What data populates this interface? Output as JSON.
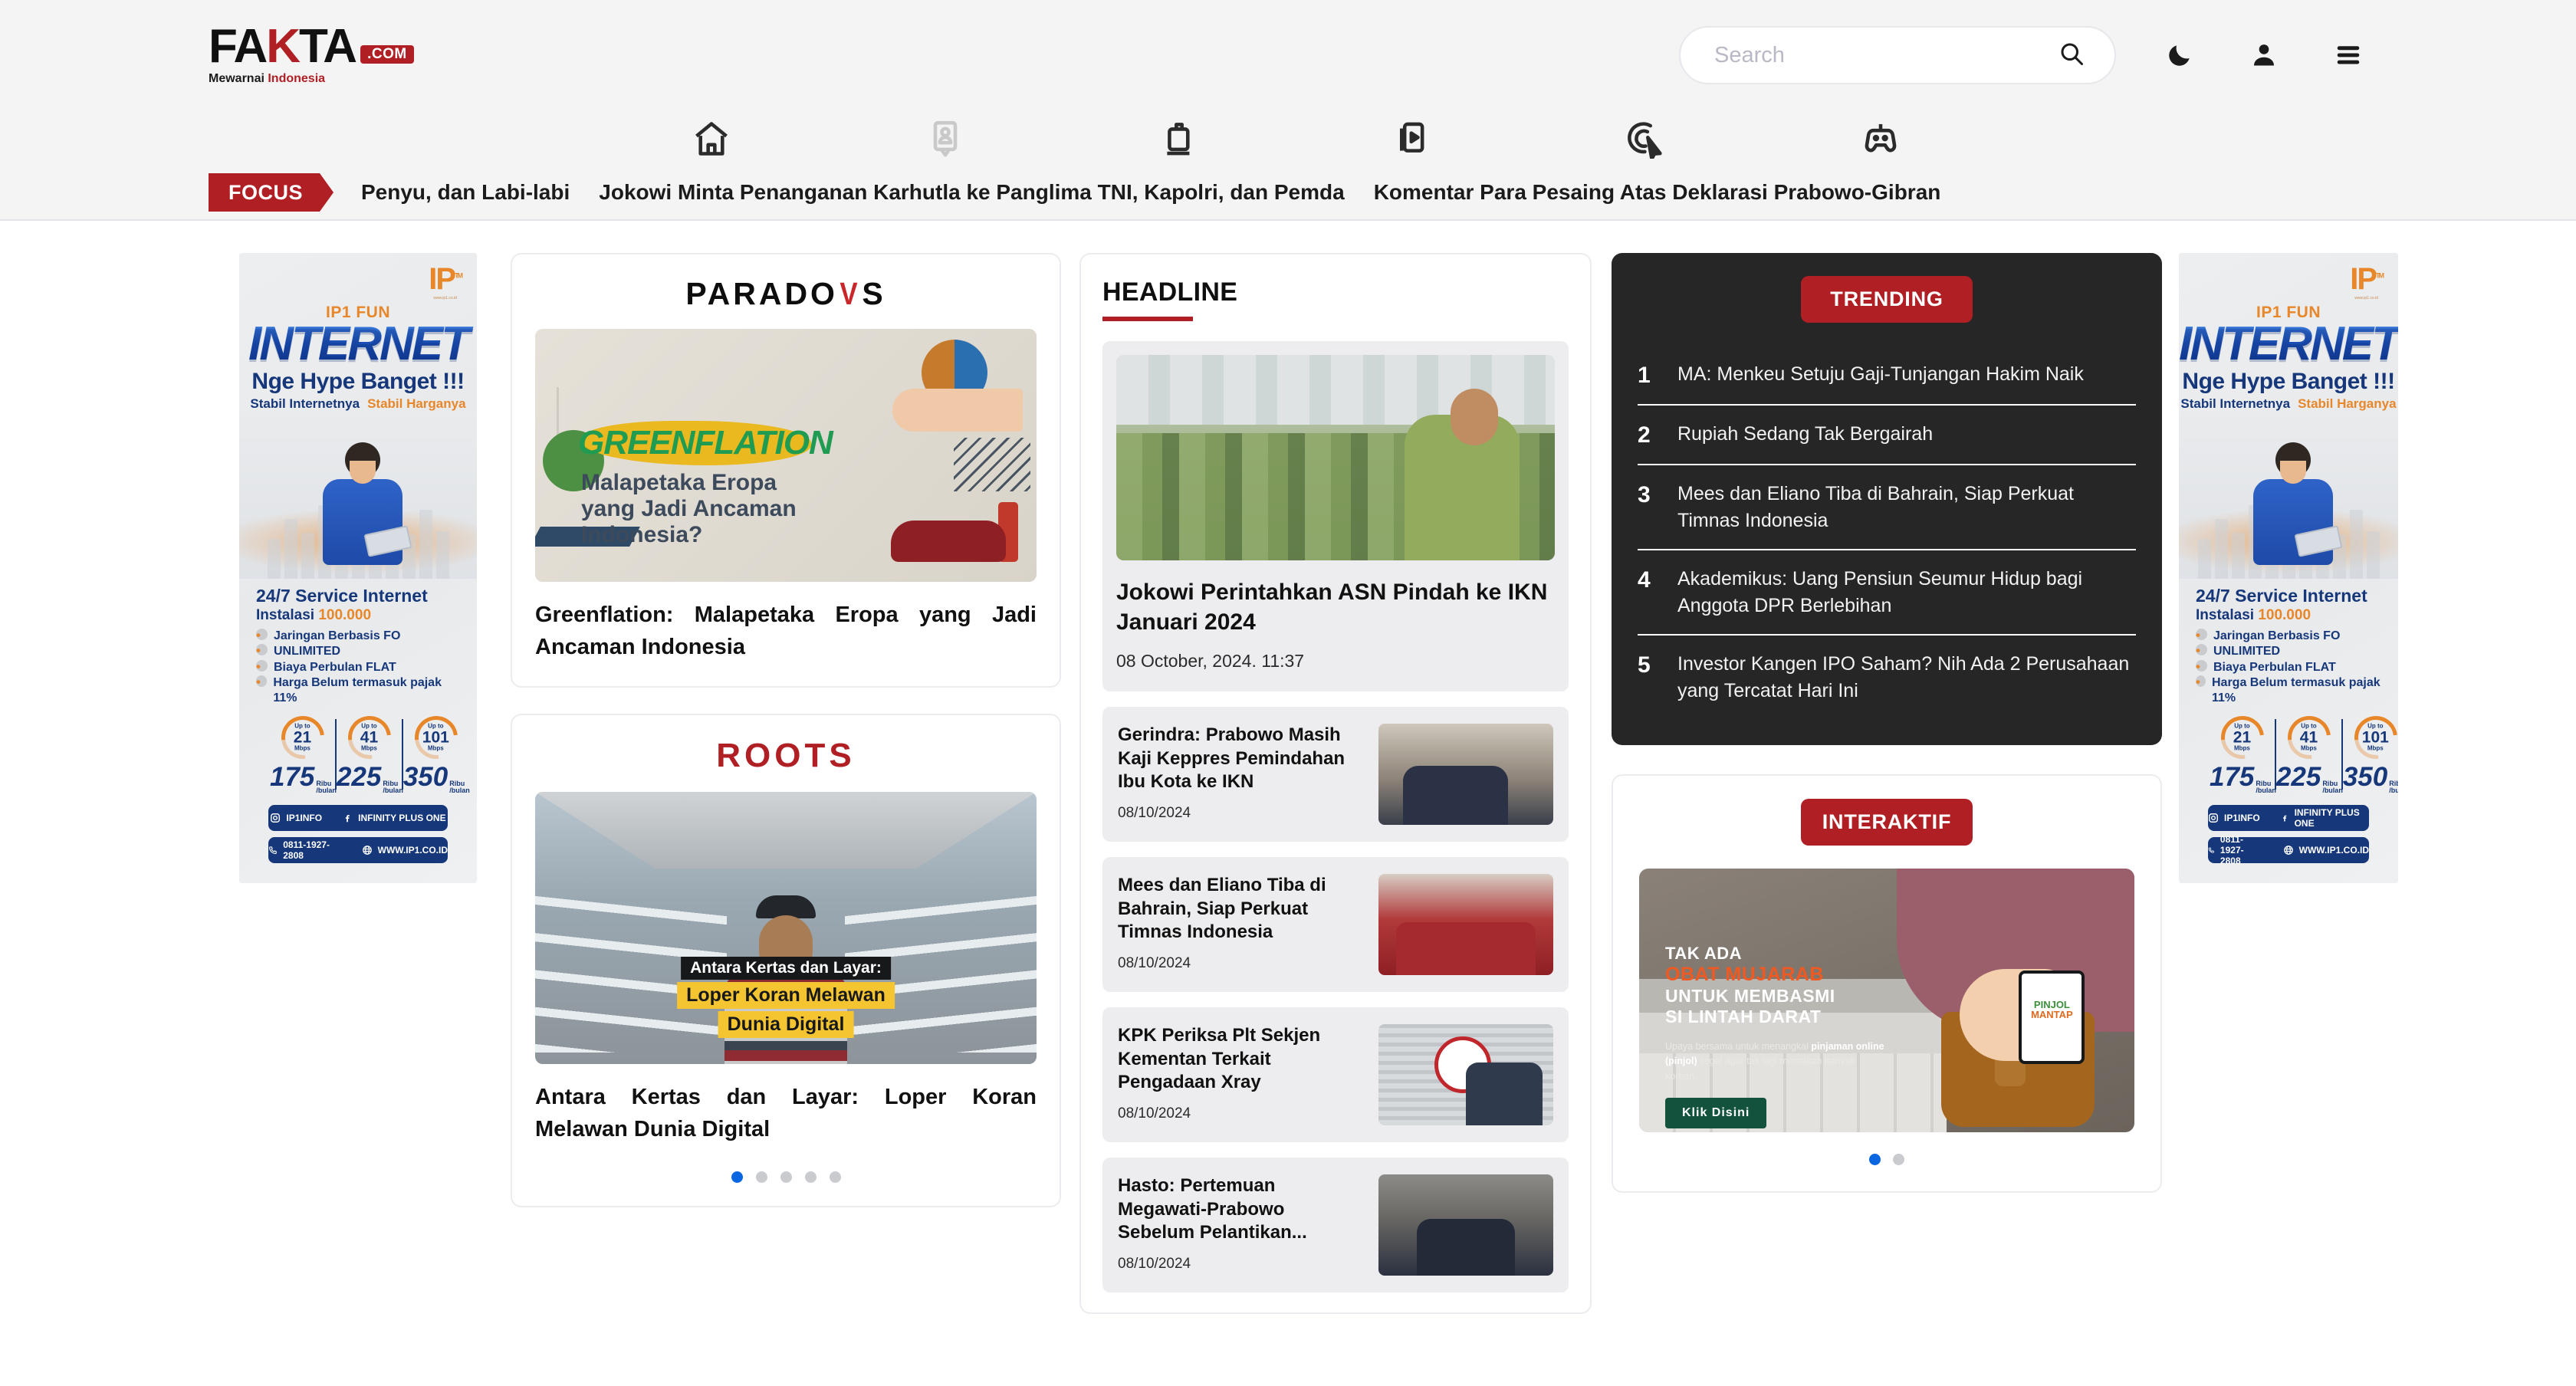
{
  "site": {
    "logo_main": "FA",
    "logo_check": "K",
    "logo_rest": "TA",
    "logo_dotcom": ".COM",
    "tagline_a": "Mewarnai ",
    "tagline_b": "Indonesia"
  },
  "search": {
    "placeholder": "Search",
    "value": ""
  },
  "header_icons": [
    {
      "name": "dark-mode-icon",
      "label": "Dark mode"
    },
    {
      "name": "account-icon",
      "label": "Account"
    },
    {
      "name": "menu-icon",
      "label": "Menu"
    }
  ],
  "nav": [
    {
      "name": "home",
      "label": "Home"
    },
    {
      "name": "profile",
      "label": "Profil"
    },
    {
      "name": "briefcase",
      "label": "Bisnis"
    },
    {
      "name": "video",
      "label": "Video"
    },
    {
      "name": "click",
      "label": "Interaktif"
    },
    {
      "name": "gamepad",
      "label": "Game"
    }
  ],
  "focus": {
    "badge": "FOCUS",
    "items": [
      "Penyu, dan Labi-labi",
      "Jokowi Minta Penanganan Karhutla ke Panglima TNI, Kapolri, dan Pemda",
      "Komentar Para Pesaing Atas Deklarasi Prabowo-Gibran"
    ]
  },
  "ad": {
    "ip1_mark": "IP",
    "ip1_one": "1",
    "ip1_tm": "TM",
    "ip1_sub": "Your Trusted IoT Partner\nwww.ip1.co.id",
    "fun": "IP1 FUN",
    "internet": "INTERNET",
    "hype": "Nge Hype Banget !!!",
    "stabil_net": "Stabil Internetnya",
    "stabil_harga": "Stabil Harganya",
    "service_title": "24/7 Service Internet",
    "instalasi_label": "Instalasi ",
    "instalasi_value": "100.000",
    "features": [
      "Jaringan Berbasis FO",
      "UNLIMITED",
      "Biaya Perbulan FLAT",
      "Harga Belum termasuk pajak 11%"
    ],
    "speeds": [
      {
        "upto": "Up to",
        "num": "21",
        "unit": "Mbps",
        "price": "175",
        "per_a": "Ribu",
        "per_b": "/bulan"
      },
      {
        "upto": "Up to",
        "num": "41",
        "unit": "Mbps",
        "price": "225",
        "per_a": "Ribu",
        "per_b": "/bulan"
      },
      {
        "upto": "Up to",
        "num": "101",
        "unit": "Mbps",
        "price": "350",
        "per_a": "Ribu",
        "per_b": "/bulan"
      }
    ],
    "instagram": "IP1INFO",
    "facebook": "INFINITY PLUS ONE",
    "phone": "0811-1927-2808",
    "website": "WWW.IP1.CO.ID"
  },
  "feature_cards": [
    {
      "brand": "PARADOKS",
      "brand_pre": "PARADO",
      "brand_v": "V",
      "brand_post": "S",
      "art": {
        "word": "GREENFLATION",
        "sub_l1": "Malapetaka Eropa",
        "sub_l2": "yang Jadi Ancaman",
        "sub_l3": "Indonesia?"
      },
      "title": "Greenflation: Malapetaka Eropa yang Jadi Ancaman Indonesia"
    },
    {
      "brand": "ROOTS",
      "brand_pre": "ROO",
      "brand_v": "T",
      "brand_post": "S",
      "art": {
        "cap1": "Antara Kertas dan Layar:",
        "cap2": "Loper Koran Melawan",
        "cap3": "Dunia Digital"
      },
      "title": "Antara Kertas dan Layar: Loper Koran Melawan Dunia Digital",
      "dots": {
        "count": 5,
        "active": 0
      }
    }
  ],
  "headline": {
    "section_title": "HEADLINE",
    "main": {
      "title": "Jokowi Perintahkan ASN Pindah ke IKN Januari 2024",
      "date": "08 October, 2024. 11:37"
    },
    "items": [
      {
        "title": "Gerindra: Prabowo Masih Kaji Keppres Pemindahan Ibu Kota ke IKN",
        "date": "08/10/2024"
      },
      {
        "title": "Mees dan Eliano Tiba di Bahrain, Siap Perkuat Timnas Indonesia",
        "date": "08/10/2024"
      },
      {
        "title": "KPK Periksa Plt Sekjen Kementan Terkait Pengadaan Xray",
        "date": "08/10/2024"
      },
      {
        "title": "Hasto: Pertemuan Megawati-Prabowo Sebelum Pelantikan...",
        "date": "08/10/2024"
      }
    ]
  },
  "trending": {
    "title": "TRENDING",
    "items": [
      {
        "rank": "1",
        "title": "MA: Menkeu Setuju Gaji-Tunjangan Hakim Naik"
      },
      {
        "rank": "2",
        "title": "Rupiah Sedang Tak Bergairah"
      },
      {
        "rank": "3",
        "title": "Mees dan Eliano Tiba di Bahrain, Siap Perkuat Timnas Indonesia"
      },
      {
        "rank": "4",
        "title": "Akademikus: Uang Pensiun Seumur Hidup bagi Anggota DPR Berlebihan"
      },
      {
        "rank": "5",
        "title": "Investor Kangen IPO Saham? Nih Ada 2 Perusahaan yang Tercatat Hari Ini"
      }
    ]
  },
  "interaktif": {
    "title": "INTERAKTIF",
    "slide": {
      "l1": "TAK ADA",
      "l2": "OBAT MUJARAB",
      "l3": "UNTUK MEMBASMI",
      "l4": "SI LINTAH DARAT",
      "desc_a": "Upaya bersama untuk menangkal ",
      "desc_b": "pinjaman online (pinjol)",
      "desc_c": " ilegal agar tak lagi memakan banyak korban.",
      "button": "Klik Disini",
      "phone_a": "PINJOL",
      "phone_b": "MANTAP"
    },
    "dots": {
      "count": 2,
      "active": 0
    }
  },
  "colors": {
    "brand_red": "#b01f24",
    "dark_panel": "#262626",
    "accent_blue": "#0a66e0",
    "ad_blue": "#16377a",
    "ad_orange": "#e8872a"
  }
}
